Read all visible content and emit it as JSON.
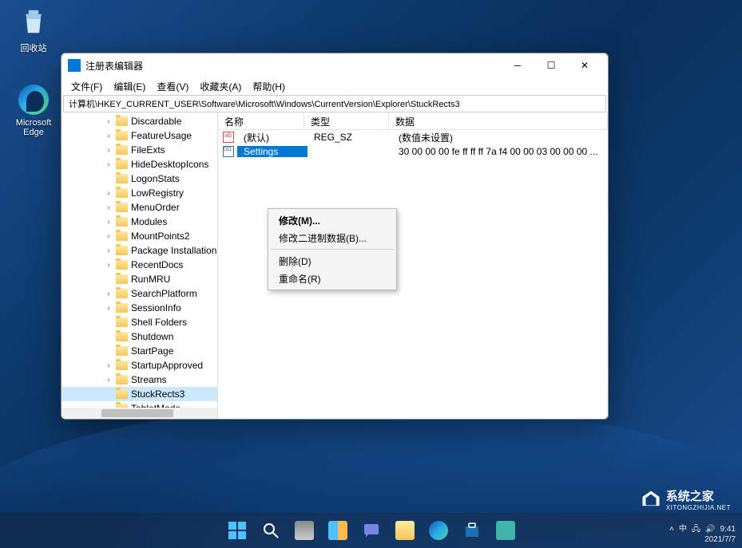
{
  "desktop": {
    "recycle_bin": "回收站",
    "edge": "Microsoft Edge"
  },
  "window": {
    "title": "注册表编辑器",
    "menus": [
      "文件(F)",
      "编辑(E)",
      "查看(V)",
      "收藏夹(A)",
      "帮助(H)"
    ],
    "address": "计算机\\HKEY_CURRENT_USER\\Software\\Microsoft\\Windows\\CurrentVersion\\Explorer\\StuckRects3"
  },
  "tree": [
    {
      "label": "Discardable",
      "exp": "›"
    },
    {
      "label": "FeatureUsage",
      "exp": "›"
    },
    {
      "label": "FileExts",
      "exp": "›"
    },
    {
      "label": "HideDesktopIcons",
      "exp": "›"
    },
    {
      "label": "LogonStats",
      "exp": ""
    },
    {
      "label": "LowRegistry",
      "exp": "›"
    },
    {
      "label": "MenuOrder",
      "exp": "›"
    },
    {
      "label": "Modules",
      "exp": "›"
    },
    {
      "label": "MountPoints2",
      "exp": "›"
    },
    {
      "label": "Package Installation",
      "exp": "›"
    },
    {
      "label": "RecentDocs",
      "exp": "›"
    },
    {
      "label": "RunMRU",
      "exp": ""
    },
    {
      "label": "SearchPlatform",
      "exp": "›"
    },
    {
      "label": "SessionInfo",
      "exp": "›"
    },
    {
      "label": "Shell Folders",
      "exp": ""
    },
    {
      "label": "Shutdown",
      "exp": ""
    },
    {
      "label": "StartPage",
      "exp": ""
    },
    {
      "label": "StartupApproved",
      "exp": "›"
    },
    {
      "label": "Streams",
      "exp": "›"
    },
    {
      "label": "StuckRects3",
      "exp": "",
      "selected": true
    },
    {
      "label": "TabletMode",
      "exp": ""
    }
  ],
  "list": {
    "columns": {
      "name": "名称",
      "type": "类型",
      "data": "数据"
    },
    "rows": [
      {
        "icon": "string",
        "name": "(默认)",
        "type": "REG_SZ",
        "data": "(数值未设置)"
      },
      {
        "icon": "binary",
        "name": "Settings",
        "type": "",
        "data": "30 00 00 00 fe ff ff ff 7a f4 00 00 03 00 00 00 ...",
        "selected": true
      }
    ]
  },
  "context_menu": {
    "modify": "修改(M)...",
    "modify_binary": "修改二进制数据(B)...",
    "delete": "删除(D)",
    "rename": "重命名(R)"
  },
  "tray": {
    "ime": "中",
    "time": "9:41",
    "date": "2021/7/7"
  },
  "watermark": {
    "text": "系统之家",
    "sub": "XITONGZHIJIA.NET"
  }
}
